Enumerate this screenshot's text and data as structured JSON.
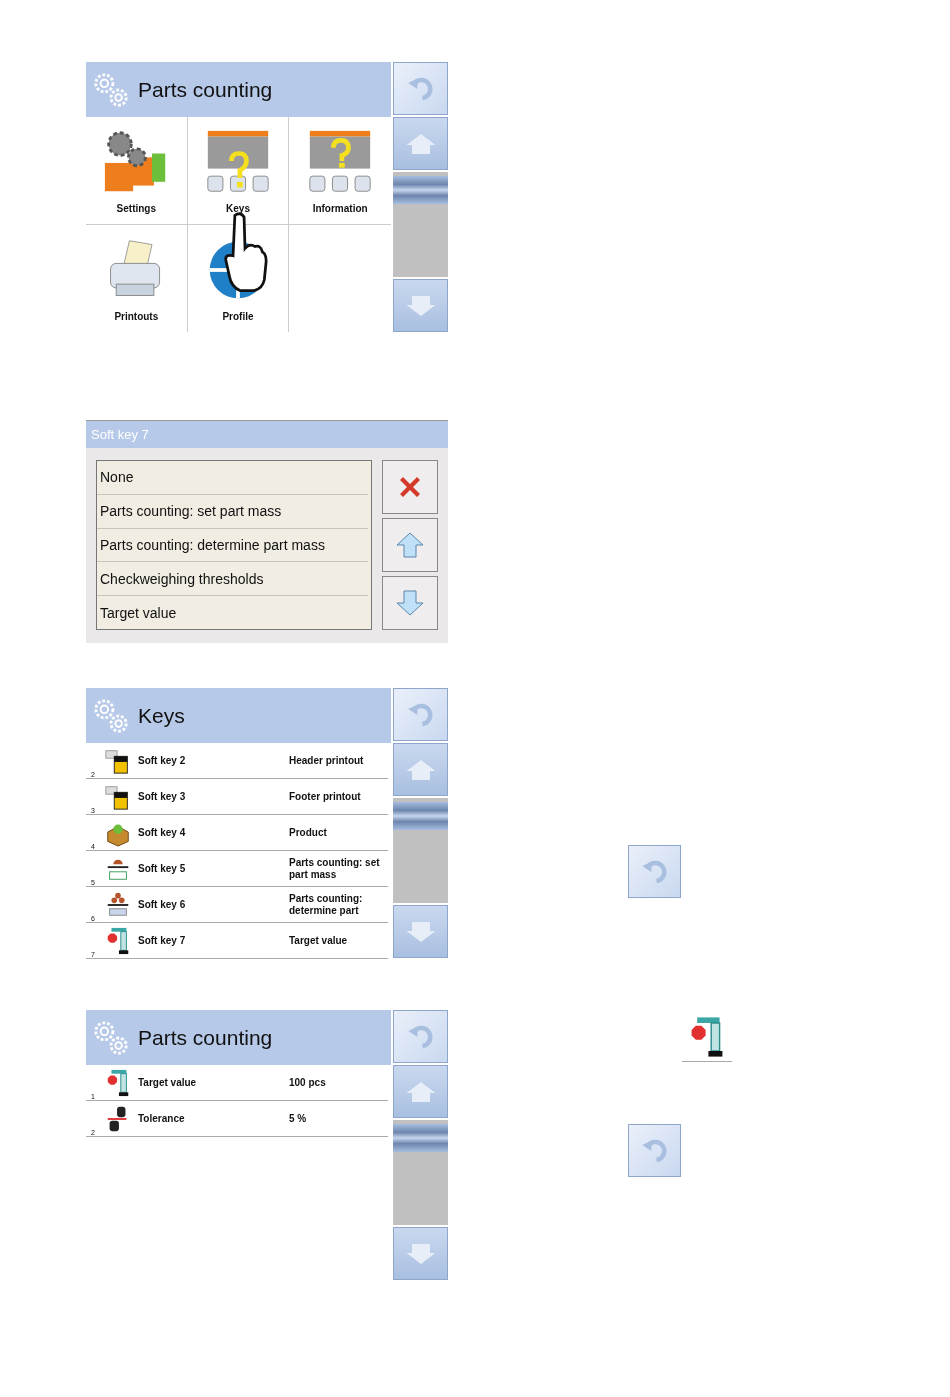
{
  "menu_screen": {
    "title": "Parts counting",
    "tiles": [
      {
        "label": "Settings"
      },
      {
        "label": "Keys"
      },
      {
        "label": "Information"
      },
      {
        "label": "Printouts"
      },
      {
        "label": "Profile"
      }
    ]
  },
  "softkey_dialog": {
    "title": "Soft key 7",
    "options": [
      "None",
      "Parts counting: set part mass",
      "Parts counting: determine part mass",
      "Checkweighing thresholds",
      "Target value"
    ]
  },
  "keys_screen": {
    "title": "Keys",
    "rows": [
      {
        "number": "2",
        "name": "Soft key 2",
        "value": "Header printout"
      },
      {
        "number": "3",
        "name": "Soft key 3",
        "value": "Footer printout"
      },
      {
        "number": "4",
        "name": "Soft key 4",
        "value": "Product"
      },
      {
        "number": "5",
        "name": "Soft key 5",
        "value": "Parts counting: set part mass"
      },
      {
        "number": "6",
        "name": "Soft key 6",
        "value": "Parts counting: determine part"
      },
      {
        "number": "7",
        "name": "Soft key 7",
        "value": "Target value"
      }
    ]
  },
  "counting_screen": {
    "title": "Parts counting",
    "rows": [
      {
        "number": "1",
        "name": "Target value",
        "value": "100 pcs"
      },
      {
        "number": "2",
        "name": "Tolerance",
        "value": "5 %"
      }
    ]
  }
}
